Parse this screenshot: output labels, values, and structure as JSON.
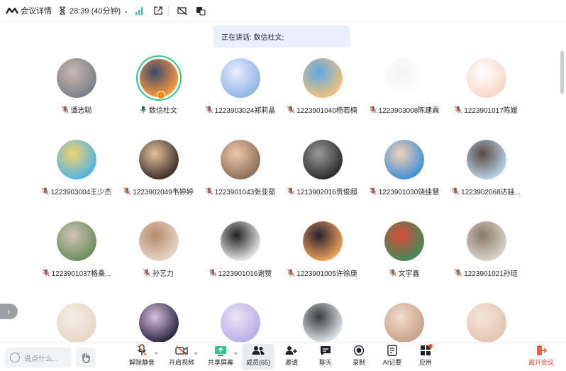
{
  "topbar": {
    "meeting_details": "会议详情",
    "timer": "28:39 (40分钟)"
  },
  "speaking_banner": "正在讲话: 数信杜文;",
  "participants": [
    {
      "name": "谭志聪",
      "mic": "muted",
      "colors": [
        "#7a7f88",
        "#c9b8b0"
      ]
    },
    {
      "name": "数信杜文",
      "mic": "on",
      "colors": [
        "#ff9a3c",
        "#3a4a6b"
      ],
      "speaking": true
    },
    {
      "name": "1223903024郑莉晶",
      "mic": "muted",
      "colors": [
        "#8fb4e8",
        "#e7eefb"
      ]
    },
    {
      "name": "1223901040杨若楠",
      "mic": "muted",
      "colors": [
        "#f3c07a",
        "#5aa9e6"
      ]
    },
    {
      "name": "1223903008陈建霖",
      "mic": "muted",
      "colors": [
        "#ffffff",
        "#f4f4f4"
      ]
    },
    {
      "name": "1223901017陈媛",
      "mic": "muted",
      "colors": [
        "#f6d8c7",
        "#ffffff"
      ]
    },
    {
      "name": "1223903004王少杰",
      "mic": "muted",
      "colors": [
        "#4fb3e6",
        "#f3d36b"
      ]
    },
    {
      "name": "1223902049韦婷婷",
      "mic": "muted",
      "colors": [
        "#3b2d2a",
        "#e3c49a"
      ]
    },
    {
      "name": "1223901043张亚茹",
      "mic": "muted",
      "colors": [
        "#8a6d5a",
        "#f1c8a8"
      ]
    },
    {
      "name": "1213902016贡俊超",
      "mic": "muted",
      "colors": [
        "#2b2b2b",
        "#9a9a9a"
      ]
    },
    {
      "name": "1223901030饶佳慧",
      "mic": "muted",
      "colors": [
        "#3f8fd8",
        "#f3d1b4"
      ]
    },
    {
      "name": "1223902068达娃...",
      "mic": "muted",
      "colors": [
        "#b9d3e8",
        "#5a4a44"
      ]
    },
    {
      "name": "1223901037格桑...",
      "mic": "muted",
      "colors": [
        "#6d8c5a",
        "#cfc5b9"
      ]
    },
    {
      "name": "孙艺力",
      "mic": "muted",
      "colors": [
        "#e6d6c8",
        "#b58a6a"
      ]
    },
    {
      "name": "1223901016谢赞",
      "mic": "muted",
      "colors": [
        "#e9e9e9",
        "#222222"
      ]
    },
    {
      "name": "1223901005许徐庚",
      "mic": "muted",
      "colors": [
        "#f0a35a",
        "#2a2030"
      ]
    },
    {
      "name": "文宇鑫",
      "mic": "muted",
      "colors": [
        "#3f8c5a",
        "#d94a3a"
      ]
    },
    {
      "name": "1223901021孙琏",
      "mic": "muted",
      "colors": [
        "#d9d4cc",
        "#8a7a6a"
      ]
    },
    {
      "name": "",
      "mic": "muted",
      "colors": [
        "#e8d6c4",
        "#f4eee8"
      ]
    },
    {
      "name": "",
      "mic": "muted",
      "colors": [
        "#2a2440",
        "#d9c0e0"
      ]
    },
    {
      "name": "",
      "mic": "muted",
      "colors": [
        "#b9aee6",
        "#e9e4f7"
      ]
    },
    {
      "name": "",
      "mic": "muted",
      "colors": [
        "#dfe6ea",
        "#3a3a3a"
      ]
    },
    {
      "name": "",
      "mic": "muted",
      "colors": [
        "#c7a08a",
        "#f2dccb"
      ]
    },
    {
      "name": "",
      "mic": "muted",
      "colors": [
        "#e3c4b0",
        "#f6e6da"
      ]
    }
  ],
  "bottombar": {
    "chat_placeholder": "说点什么...",
    "unmute": "解除静音",
    "start_video": "开启视频",
    "share_screen": "共享屏幕",
    "members": "成员(65)",
    "invite": "邀请",
    "chat": "聊天",
    "record": "录制",
    "ai_notes": "AI记要",
    "apps": "应用",
    "leave": "离开会议"
  },
  "colors": {
    "accent_green": "#2fc48c",
    "muted_red": "#e8462e",
    "banner_bg": "#e8f0fd"
  }
}
